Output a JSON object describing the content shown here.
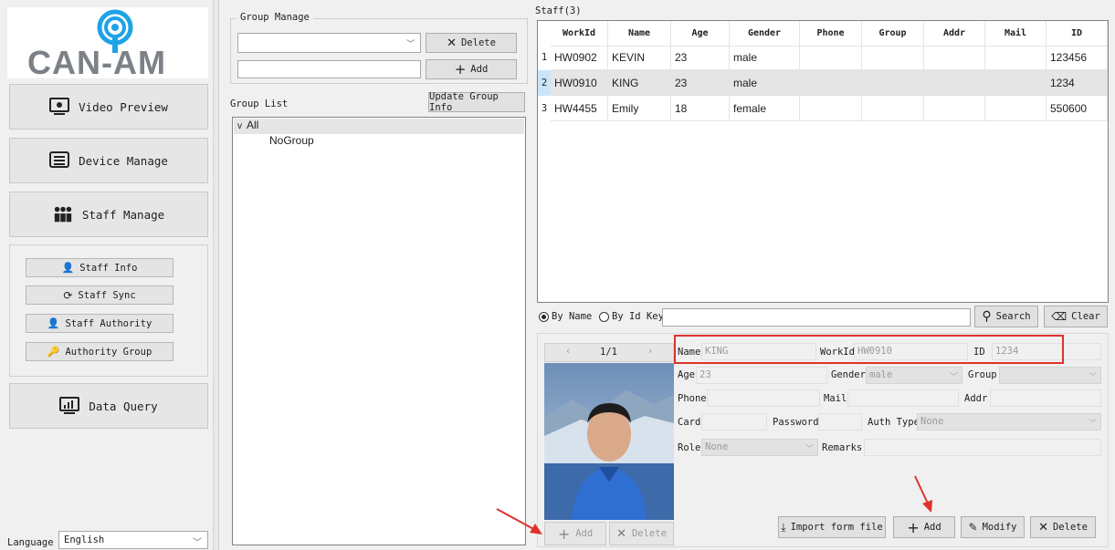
{
  "logo": {
    "text": "CAN-AM"
  },
  "nav": {
    "video_preview": "Video Preview",
    "device_manage": "Device Manage",
    "staff_manage": "Staff Manage",
    "data_query": "Data Query"
  },
  "subnav": {
    "staff_info": "Staff Info",
    "staff_sync": "Staff Sync",
    "staff_authority": "Staff Authority",
    "authority_group": "Authority Group"
  },
  "language": {
    "label": "Language",
    "value": "English"
  },
  "group_manage": {
    "title": "Group Manage",
    "delete_label": "Delete",
    "add_label": "Add",
    "group_list_label": "Group List",
    "update_label": "Update Group Info",
    "tree": {
      "root": "All",
      "child": "NoGroup"
    }
  },
  "staff": {
    "title": "Staff(3)",
    "columns": [
      "WorkId",
      "Name",
      "Age",
      "Gender",
      "Phone",
      "Group",
      "Addr",
      "Mail",
      "ID"
    ],
    "rows": [
      {
        "num": "1",
        "workid": "HW0902",
        "name": "KEVIN",
        "age": "23",
        "gender": "male",
        "id": "123456"
      },
      {
        "num": "2",
        "workid": "HW0910",
        "name": "KING",
        "age": "23",
        "gender": "male",
        "id": "1234"
      },
      {
        "num": "3",
        "workid": "HW4455",
        "name": "Emily",
        "age": "18",
        "gender": "female",
        "id": "550600"
      }
    ]
  },
  "search": {
    "by_name": "By Name",
    "by_id": "By Id Key",
    "search_label": "Search",
    "clear_label": "Clear"
  },
  "detail": {
    "pager": "1/1",
    "name_label": "Name",
    "name_value": "KING",
    "workid_label": "WorkId",
    "workid_value": "HW0910",
    "id_label": "ID",
    "id_value": "1234",
    "age_label": "Age",
    "age_value": "23",
    "gender_label": "Gender",
    "gender_value": "male",
    "group_label": "Group",
    "phone_label": "Phone",
    "mail_label": "Mail",
    "addr_label": "Addr",
    "card_label": "Card",
    "password_label": "Password",
    "auth_type_label": "Auth Type",
    "auth_type_value": "None",
    "role_label": "Role",
    "role_value": "None",
    "remarks_label": "Remarks",
    "photo_add": "Add",
    "photo_delete": "Delete",
    "import_label": "Import form file",
    "add_label": "Add",
    "modify_label": "Modify",
    "delete_label": "Delete"
  }
}
